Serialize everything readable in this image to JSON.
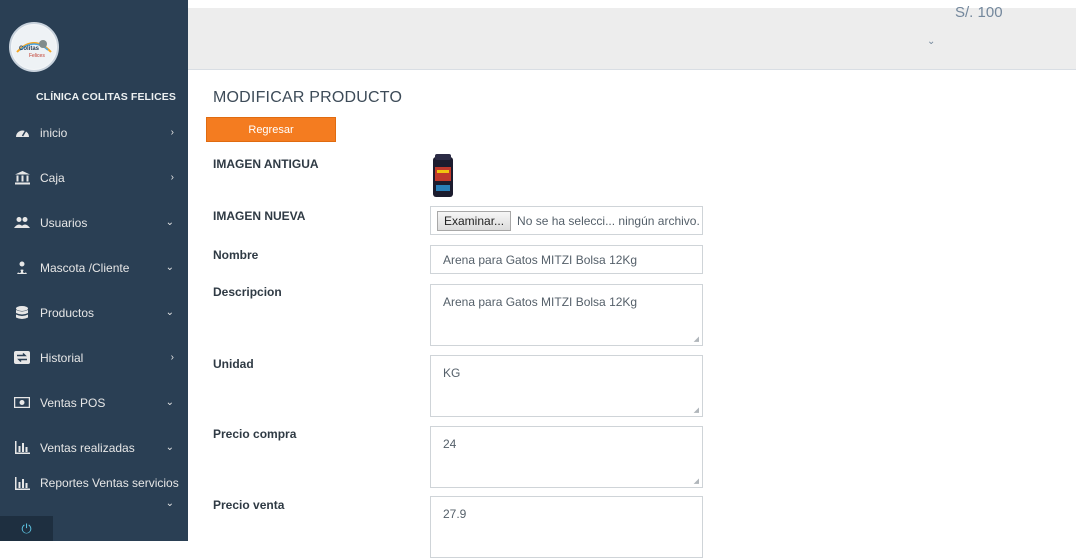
{
  "sidebar": {
    "brand": "CLÍNICA COLITAS FELICES",
    "logo_text": "Colitas Felices",
    "items": [
      {
        "label": "inicio",
        "icon": "dashboard-icon",
        "arrow": "›"
      },
      {
        "label": "Caja",
        "icon": "bank-icon",
        "arrow": "›"
      },
      {
        "label": "Usuarios",
        "icon": "users-icon",
        "arrow": "⌄"
      },
      {
        "label": "Mascota /Cliente",
        "icon": "pet-client-icon",
        "arrow": "⌄"
      },
      {
        "label": "Productos",
        "icon": "database-icon",
        "arrow": "⌄"
      },
      {
        "label": "Historial",
        "icon": "exchange-icon",
        "arrow": "›"
      },
      {
        "label": "Ventas POS",
        "icon": "money-icon",
        "arrow": "⌄"
      },
      {
        "label": "Ventas realizadas",
        "icon": "bar-chart-icon",
        "arrow": "⌄"
      },
      {
        "label": "Reportes Ventas servicios",
        "icon": "bar-chart-icon",
        "arrow": "⌄"
      }
    ],
    "power_icon": "⏻"
  },
  "topbar": {
    "balance": "S/. 100",
    "chevron": "⌄"
  },
  "main": {
    "title": "MODIFICAR PRODUCTO",
    "back_button": "Regresar",
    "labels": {
      "old_image": "IMAGEN ANTIGUA",
      "new_image": "IMAGEN NUEVA",
      "name": "Nombre",
      "description": "Descripcion",
      "unit": "Unidad",
      "buy_price": "Precio compra",
      "sell_price": "Precio venta"
    },
    "file_input": {
      "button": "Examinar...",
      "status": "No se ha selecci... ningún archivo."
    },
    "values": {
      "name": "Arena para Gatos MITZI Bolsa 12Kg",
      "description": "Arena para Gatos MITZI Bolsa 12Kg",
      "unit": "KG",
      "buy_price": "24",
      "sell_price": "27.9"
    }
  },
  "colors": {
    "sidebar": "#2a3f54",
    "accent": "#f47c20",
    "topbar": "#ededed"
  }
}
